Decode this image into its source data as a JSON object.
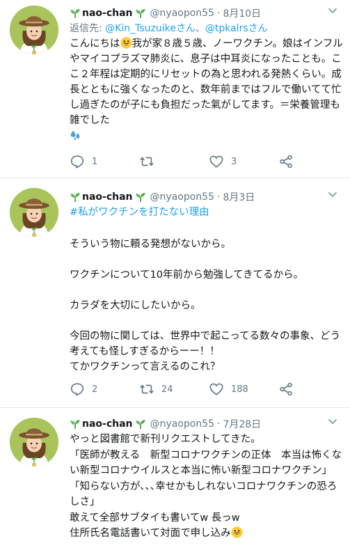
{
  "tweets": [
    {
      "name": "nao-chan",
      "handle": "@nyaopon55",
      "dot": "·",
      "date": "8月10日",
      "reply_prefix": "返信先: ",
      "reply_user1": "@Kin_Tsuzuikeさん",
      "reply_sep": "、",
      "reply_user2": "@tpkalrsさん",
      "text_a": "こんにちは",
      "text_b": "我が家８歳５歳、ノーワクチン。娘はインフルやマイコプラズマ肺炎に、息子は中耳炎になったことも。ここ２年程は定期的にリセットの為と思われる発熱くらい。成長とともに強くなったのと、数年前まではフルで働いてて忙し過ぎたのが子にも負担だった氣がしてます。＝栄養管理も雑でした",
      "replies": "1",
      "retweets": "",
      "likes": "3"
    },
    {
      "name": "nao-chan",
      "handle": "@nyaopon55",
      "dot": "·",
      "date": "8月3日",
      "hashtag": "#私がワクチンを打たない理由",
      "text": "そういう物に頼る発想がないから。\n\nワクチンについて10年前から勉強してきてるから。\n\nカラダを大切にしたいから。\n\n今回の物に関しては、世界中で起こってる数々の事象、どう考えても怪しすぎるからーー！！\nてかワクチンって言えるのこれ？",
      "replies": "2",
      "retweets": "24",
      "likes": "188"
    },
    {
      "name": "nao-chan",
      "handle": "@nyaopon55",
      "dot": "·",
      "date": "7月28日",
      "text_a": "やっと図書館で新刊リクエストしてきた。\n「医師が教える　新型コロナワクチンの正体　本当は怖くない新型コロナウイルスと本当に怖い新型コロナワクチン」\n「知らない方が､､､幸せかもしれないコロナワクチンの恐ろしさ」\n敢えて全部サブタイも書いてw 長っw\n住所氏名電話書いて対面で申し込み",
      "replies": "",
      "retweets": "",
      "likes": ""
    }
  ],
  "colors": {
    "link": "#1da1f2",
    "muted": "#657786",
    "avatar_bg": "#a9c45a",
    "sprout": "#4caf50"
  }
}
